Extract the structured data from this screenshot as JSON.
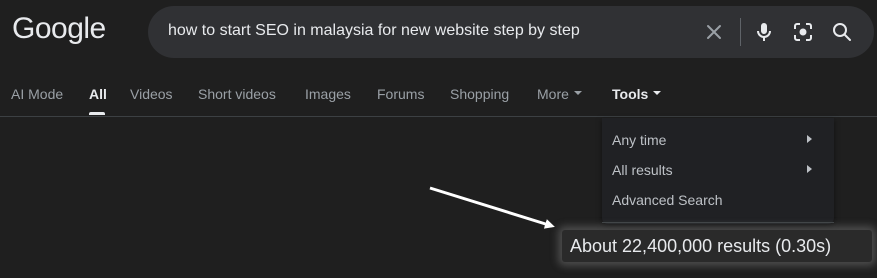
{
  "header": {
    "logo_text": "Google",
    "search": {
      "query": "how to start SEO in malaysia for new website step by step",
      "icons": [
        "close-icon",
        "mic-icon",
        "lens-icon",
        "search-icon"
      ]
    }
  },
  "tabs": [
    {
      "label": "AI Mode"
    },
    {
      "label": "All"
    },
    {
      "label": "Videos"
    },
    {
      "label": "Short videos"
    },
    {
      "label": "Images"
    },
    {
      "label": "Forums"
    },
    {
      "label": "Shopping"
    },
    {
      "label": "More"
    },
    {
      "label": "Tools"
    }
  ],
  "tools_menu": {
    "items": [
      {
        "label": "Any time",
        "has_submenu": true
      },
      {
        "label": "All results",
        "has_submenu": true
      },
      {
        "label": "Advanced Search",
        "has_submenu": false
      }
    ]
  },
  "result_stats": "About 22,400,000 results (0.30s)",
  "colors": {
    "background": "#1f1f1f",
    "search_box": "#303134",
    "text_primary": "#e8eaed",
    "text_secondary": "#9aa0a6",
    "annotation_arrow": "#ffffff"
  }
}
